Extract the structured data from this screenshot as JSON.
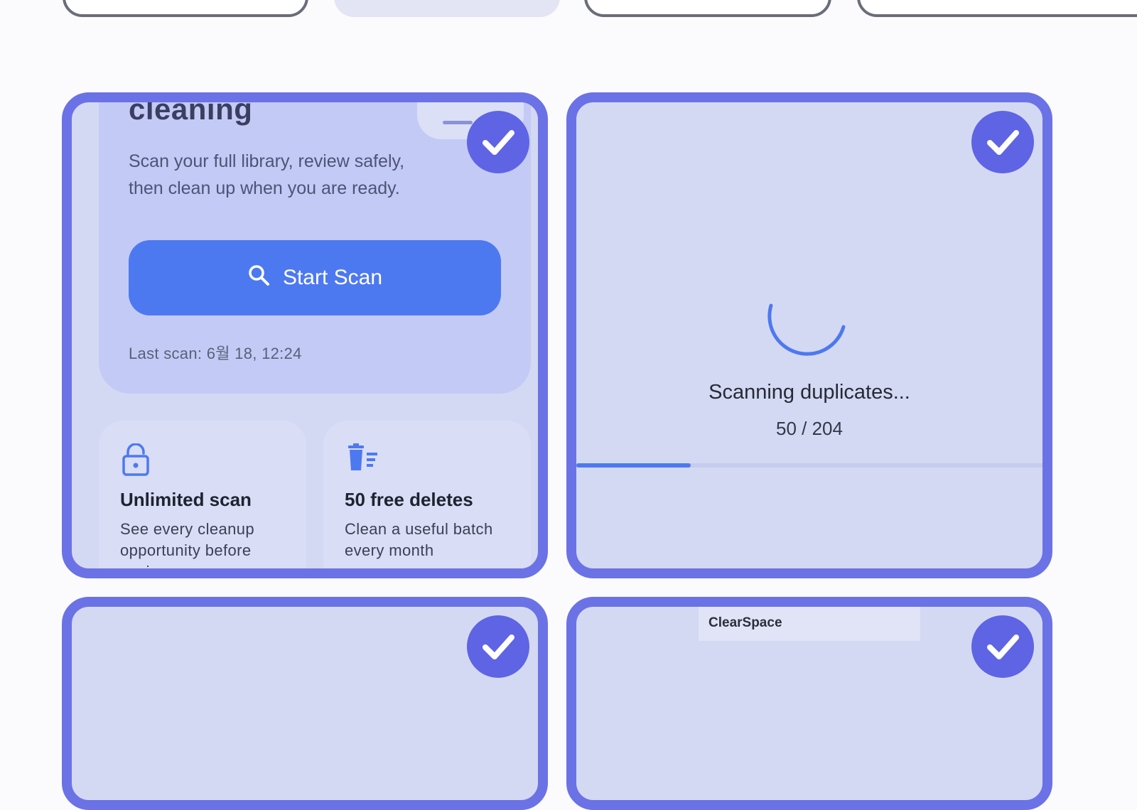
{
  "tiles": {
    "onboarding": {
      "hero_title": "cleaning",
      "hero_description": "Scan your full library, review safely, then clean up when you are ready.",
      "scan_button_label": "Start Scan",
      "last_scan": "Last scan: 6월 18, 12:24",
      "features": [
        {
          "icon": "lock-open-icon",
          "title": "Unlimited scan",
          "description": "See every cleanup opportunity before paying"
        },
        {
          "icon": "trash-list-icon",
          "title": "50 free deletes",
          "description": "Clean a useful batch every month"
        }
      ]
    },
    "scanning": {
      "title": "Scanning duplicates...",
      "count": "50 / 204",
      "progress": 0.245
    },
    "brand": {
      "label": "ClearSpace"
    }
  },
  "colors": {
    "selection_border": "#6b72e6",
    "check_badge": "#5e64e4",
    "primary_button": "#4d79f0",
    "tile_background": "#d4d9f3"
  }
}
